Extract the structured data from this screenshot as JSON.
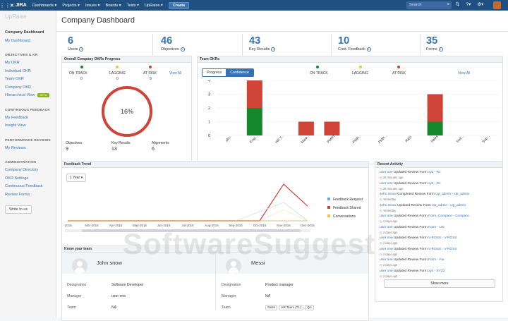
{
  "nav": {
    "logo": "JIRA",
    "items": [
      "Dashboards ▾",
      "Projects ▾",
      "Issues ▾",
      "Boards ▾",
      "Tests ▾",
      "UpRaise ▾"
    ],
    "create": "Create",
    "search_placeholder": "Search"
  },
  "sidebar": {
    "brand": "UpRaise",
    "sections": [
      {
        "header": "",
        "items": [
          "Company Dashboard",
          "My Dashboard"
        ]
      },
      {
        "header": "OBJECTIVES & KR",
        "items": [
          "My OKR",
          "Individual OKR",
          "Team OKR",
          "Company OKR",
          "Hierarchical View"
        ]
      },
      {
        "header": "CONTINUOUS FEEDBACK",
        "items": [
          "My Feedback",
          "Insight View"
        ]
      },
      {
        "header": "PERFORMANCE REVIEWS",
        "items": [
          "My Reviews"
        ]
      },
      {
        "header": "ADMINISTRATION",
        "items": [
          "Company Directory",
          "OKR Settings",
          "Continuous Feedback",
          "Review Forms"
        ]
      }
    ],
    "beta": "BETA",
    "write_button": "Write to us"
  },
  "page_title": "Company Dashboard",
  "stats": [
    {
      "value": "6",
      "label": "Users"
    },
    {
      "value": "46",
      "label": "Objectives"
    },
    {
      "value": "43",
      "label": "Key Results"
    },
    {
      "value": "10",
      "label": "Cont. Feedback"
    },
    {
      "value": "35",
      "label": "Forms"
    }
  ],
  "progress_panel": {
    "title": "Overall Company OKRs Progress",
    "statuses": [
      {
        "label": "ON TRACK",
        "count": "0",
        "color": "#14892c"
      },
      {
        "label": "LAGGING",
        "count": "0",
        "color": "#f6c342"
      },
      {
        "label": "AT RISK",
        "count": "9",
        "color": "#d04437"
      }
    ],
    "view_all": "View All",
    "percent": "16%",
    "percent_value": 16,
    "totals": [
      {
        "label": "Objectives",
        "value": "9"
      },
      {
        "label": "Key Results",
        "value": "13"
      },
      {
        "label": "Alignments",
        "value": "6"
      }
    ]
  },
  "team_panel": {
    "title": "Team OKRs",
    "toggle": [
      "Progress",
      "Confidence"
    ],
    "statuses": [
      "ON TRACK",
      "LAGGING",
      "AT RISK"
    ],
    "view_all": "View All"
  },
  "feedback_panel": {
    "title": "Feedback Trend",
    "period": "1 Year ▾",
    "legend": [
      "Feedback Request",
      "Feedback Shared",
      "Conversations"
    ]
  },
  "activity_panel": {
    "title": "Recent Activity",
    "items": [
      {
        "user": "user one",
        "action": "Updated Review Form",
        "target": "xyz - R1",
        "time": "26 minutes ago"
      },
      {
        "user": "user one",
        "action": "Updated Review Form",
        "target": "xyz - R1",
        "time": "28 minutes ago"
      },
      {
        "user": "John Snow",
        "action": "Completed Review Form",
        "target": "Up_admin - Up_admin",
        "time": "Yesterday"
      },
      {
        "user": "John Snow",
        "action": "Updated Review Form",
        "target": "Up_admin - Up_admin",
        "time": "Yesterday"
      },
      {
        "user": "user one",
        "action": "Updated Review Form",
        "target": "Form_Compare - Compare",
        "time": "2 days ago"
      },
      {
        "user": "user one",
        "action": "Updated Review Form",
        "target": "Form - UX",
        "time": "2 days ago"
      },
      {
        "user": "user one",
        "action": "Updated Review Form",
        "target": "V-ROSS - V-ROSS",
        "time": "2 days ago"
      },
      {
        "user": "user one",
        "action": "Updated Review Form",
        "target": "V-ROSS - V-ROSS",
        "time": "2 days ago"
      },
      {
        "user": "user one",
        "action": "Updated Review Form",
        "target": "Form - Fia",
        "time": "2 days ago"
      },
      {
        "user": "user one",
        "action": "Updated Review Form",
        "target": "xyz - XYZ2",
        "time": "2 days ago"
      }
    ],
    "show_more": "Show more"
  },
  "team_section": {
    "title": "Know your team",
    "members": [
      {
        "name": "John snow",
        "designation": "Software Developer",
        "manager": "user one",
        "team": [
          "NA"
        ]
      },
      {
        "name": "Messi",
        "designation": "Product manager",
        "manager": "NA",
        "team": [
          "Sales",
          "HR Team (T.L)",
          "QA"
        ]
      }
    ],
    "labels": {
      "designation": "Designation",
      "manager": "Manager",
      "team": "Team"
    }
  },
  "watermark": "SoftwareSuggest",
  "chart_data": [
    {
      "type": "bar",
      "title": "Team OKRs",
      "categories": [
        "abc",
        "Engi...",
        "HR T...",
        "Mark...",
        "PMRT",
        "PMR...",
        "PMR...",
        "R&D",
        "Sales",
        "Soft...",
        "Sup..."
      ],
      "series": [
        {
          "name": "ON TRACK",
          "color": "#14892c",
          "values": [
            0,
            2,
            0,
            0,
            0,
            0,
            0,
            0,
            1,
            0,
            0
          ]
        },
        {
          "name": "LAGGING",
          "color": "#f6c342",
          "values": [
            0,
            0,
            0,
            0,
            0,
            0,
            0,
            0,
            0,
            0,
            0
          ]
        },
        {
          "name": "AT RISK",
          "color": "#d04437",
          "values": [
            0,
            2,
            0,
            1,
            1,
            0,
            0,
            0,
            2,
            0,
            0
          ]
        }
      ],
      "yticks": [
        0,
        1,
        2,
        3,
        4
      ],
      "ylim": [
        0,
        4
      ]
    },
    {
      "type": "line",
      "title": "Feedback Trend",
      "categories": [
        "-2016",
        "Mar-2016",
        "Apr-2016",
        "May-2016",
        "Jun-2016",
        "Jul-2016",
        "Aug-2016",
        "Sep-2016",
        "Oct-2016",
        "Nov-2016",
        "Dec-2016"
      ],
      "series": [
        {
          "name": "Feedback Request",
          "color": "#6aa6e0",
          "values": [
            0,
            0,
            0,
            0,
            0,
            0,
            0,
            0,
            0,
            0,
            0
          ]
        },
        {
          "name": "Feedback Shared",
          "color": "#d04437",
          "values": [
            0,
            0,
            0,
            0,
            0,
            0,
            0,
            0,
            0,
            10,
            4
          ]
        },
        {
          "name": "Conversations",
          "color": "#f6c342",
          "values": [
            0,
            0,
            0,
            0,
            0,
            0,
            0,
            0,
            0,
            0,
            0
          ]
        }
      ],
      "ylim": [
        0,
        10
      ]
    }
  ]
}
